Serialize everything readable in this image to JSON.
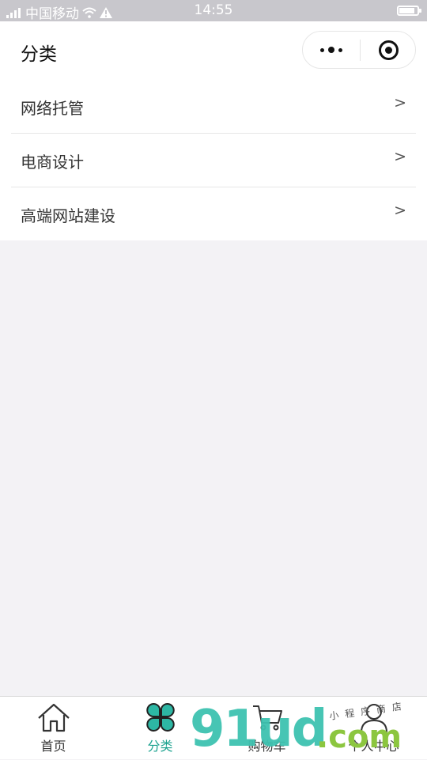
{
  "status_bar": {
    "carrier": "中国移动",
    "time": "14:55"
  },
  "header": {
    "title": "分类"
  },
  "categories": [
    {
      "label": "网络托管",
      "arrow": ">"
    },
    {
      "label": "电商设计",
      "arrow": ">"
    },
    {
      "label": "高端网站建设",
      "arrow": ">"
    }
  ],
  "tab_bar": {
    "items": [
      {
        "label": "首页",
        "icon": "home-icon"
      },
      {
        "label": "分类",
        "icon": "category-icon",
        "active": true
      },
      {
        "label": "购物车",
        "icon": "cart-icon"
      },
      {
        "label": "个人中心",
        "icon": "user-icon"
      }
    ]
  },
  "watermark": {
    "brand": "91ud",
    "suffix": ".com",
    "script_text": "小程序商店"
  },
  "colors": {
    "accent": "#1ba28f",
    "status_bar": "#c8c7cc",
    "background": "#f3f2f5"
  }
}
